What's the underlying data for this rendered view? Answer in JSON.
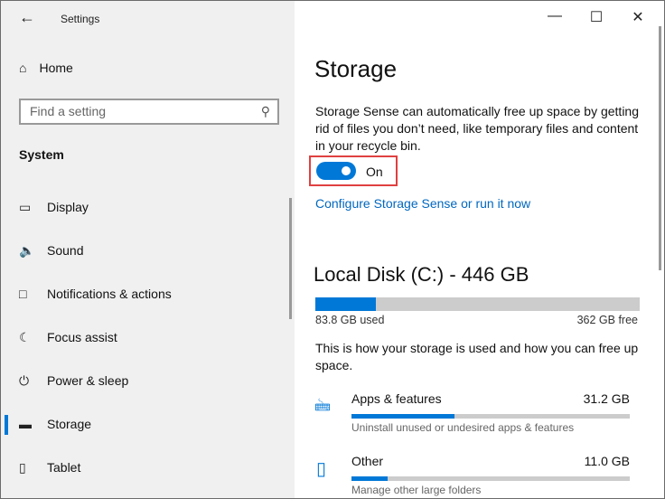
{
  "window": {
    "title": "Settings"
  },
  "sidebar": {
    "home": "Home",
    "search_placeholder": "Find a setting",
    "section": "System",
    "items": [
      {
        "label": "Display"
      },
      {
        "label": "Sound"
      },
      {
        "label": "Notifications & actions"
      },
      {
        "label": "Focus assist"
      },
      {
        "label": "Power & sleep"
      },
      {
        "label": "Storage"
      },
      {
        "label": "Tablet"
      }
    ]
  },
  "main": {
    "title": "Storage",
    "description": "Storage Sense can automatically free up space by getting rid of files you don’t need, like temporary files and content in your recycle bin.",
    "toggle_label": "On",
    "toggle_on": true,
    "configure_link": "Configure Storage Sense or run it now",
    "disk": {
      "title": "Local Disk (C:) - 446 GB",
      "used": "83.8 GB used",
      "free": "362 GB free",
      "used_fraction": 0.188
    },
    "usage_text": "This is how your storage is used and how you can free up space.",
    "categories": [
      {
        "name": "Apps & features",
        "size": "31.2 GB",
        "desc": "Uninstall unused or undesired apps & features",
        "fraction": 0.37
      },
      {
        "name": "Other",
        "size": "11.0 GB",
        "desc": "Manage other large folders",
        "fraction": 0.13
      }
    ]
  },
  "colors": {
    "accent": "#0078d7",
    "highlight": "#e04040"
  }
}
